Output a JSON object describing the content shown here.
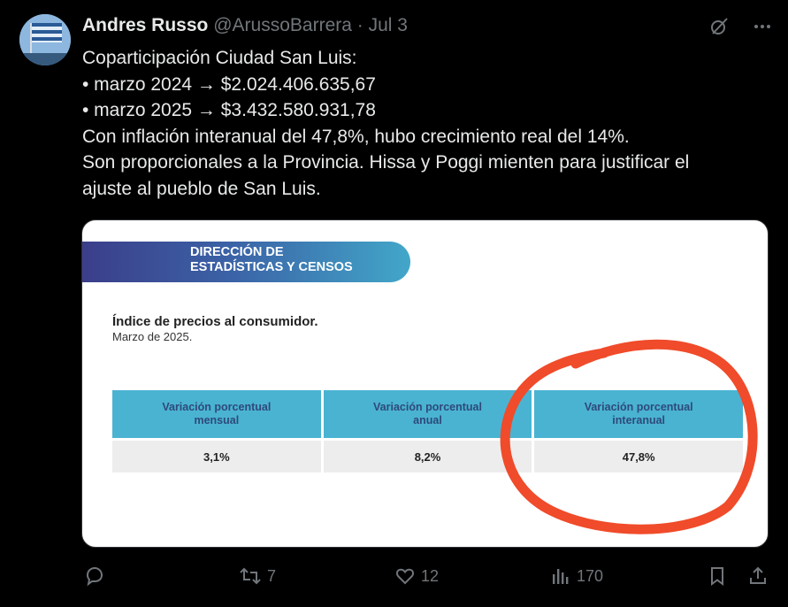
{
  "tweet": {
    "author_name": "Andres Russo",
    "handle": "@ArussoBarrera",
    "separator": "·",
    "date": "Jul 3",
    "lines": [
      "Coparticipación Ciudad San Luis:",
      "• marzo 2024 → $2.024.406.635,67",
      "• marzo 2025 → $3.432.580.931,78",
      "Con inflación interanual del 47,8%, hubo crecimiento real del 14%.",
      "Son proporcionales a la Provincia. Hissa y Poggi mienten para justificar el",
      "ajuste al pueblo de San Luis."
    ]
  },
  "image": {
    "banner_line1": "DIRECCIÓN DE",
    "banner_line2": "ESTADÍSTICAS Y CENSOS",
    "title": "Índice de precios al consumidor.",
    "subtitle": "Marzo de 2025.",
    "headers": [
      [
        "Variación porcentual",
        "mensual"
      ],
      [
        "Variación porcentual",
        "anual"
      ],
      [
        "Variación porcentual",
        "interanual"
      ]
    ],
    "values": [
      "3,1%",
      "8,2%",
      "47,8%"
    ],
    "highlight_color": "#f04b2a"
  },
  "actions": {
    "retweets": "7",
    "likes": "12",
    "views": "170"
  },
  "colors": {
    "background": "#000000",
    "text": "#e7e9ea",
    "muted": "#71767b",
    "table_header": "#4ab3d2"
  }
}
